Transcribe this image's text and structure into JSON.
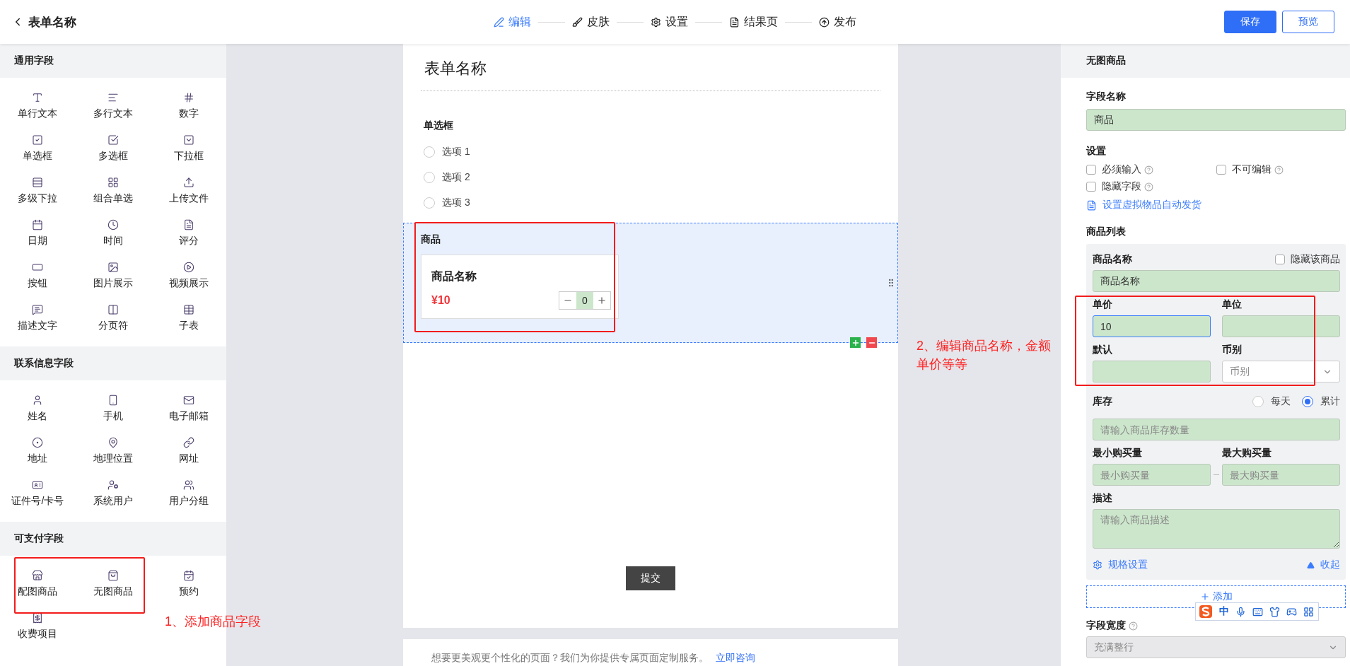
{
  "header": {
    "title": "表单名称",
    "steps": [
      {
        "label": "编辑",
        "selected": true
      },
      {
        "label": "皮肤",
        "selected": false
      },
      {
        "label": "设置",
        "selected": false
      },
      {
        "label": "结果页",
        "selected": false
      },
      {
        "label": "发布",
        "selected": false
      }
    ],
    "buttons": [
      {
        "label": "保存",
        "kind": "primary"
      },
      {
        "label": "预览",
        "kind": "outline"
      }
    ]
  },
  "sidebar": {
    "sections": [
      {
        "title": "通用字段",
        "items": [
          "单行文本",
          "多行文本",
          "数字",
          "单选框",
          "多选框",
          "下拉框",
          "多级下拉",
          "组合单选",
          "上传文件",
          "日期",
          "时间",
          "评分",
          "按钮",
          "图片展示",
          "视频展示",
          "描述文字",
          "分页符",
          "子表"
        ]
      },
      {
        "title": "联系信息字段",
        "items": [
          "姓名",
          "手机",
          "电子邮箱",
          "地址",
          "地理位置",
          "网址",
          "证件号/卡号",
          "系统用户",
          "用户分组"
        ]
      },
      {
        "title": "可支付字段",
        "items": [
          "配图商品",
          "无图商品",
          "预约",
          "收费项目"
        ]
      }
    ]
  },
  "form": {
    "title": "表单名称",
    "fields": [
      {
        "kind": "radio",
        "label": "单选框",
        "options": [
          {
            "label": "选项 1",
            "selected": false
          },
          {
            "label": "选项 2",
            "selected": false
          },
          {
            "label": "选项 3",
            "selected": false
          }
        ]
      },
      {
        "kind": "product",
        "label": "商品",
        "selected": true,
        "product_name": "商品名称",
        "price": "¥10",
        "quantity": "0"
      }
    ],
    "submit": "提交",
    "promo": {
      "text": "想要更美观更个性化的页面？我们为你提供专属页面定制服务。",
      "link": "立即咨询"
    }
  },
  "panel": {
    "title": "无图商品",
    "field_name": {
      "label": "字段名称",
      "value": "商品"
    },
    "settings": {
      "label": "设置",
      "options": [
        {
          "label": "必须输入",
          "checked": false
        },
        {
          "label": "不可编辑",
          "checked": false
        },
        {
          "label": "隐藏字段",
          "checked": false
        }
      ],
      "link": "设置虚拟物品自动发货"
    },
    "product_list": {
      "label": "商品列表",
      "name_label": "商品名称",
      "hide": {
        "label": "隐藏该商品",
        "checked": false
      },
      "name_value": "商品名称",
      "unit_price": {
        "label": "单价",
        "value": "10"
      },
      "unit": {
        "label": "单位"
      },
      "default": {
        "label": "默认"
      },
      "currency": {
        "label": "币别",
        "placeholder": "币别"
      },
      "stock": {
        "label": "库存",
        "modes": [
          {
            "label": "每天",
            "selected": false
          },
          {
            "label": "累计",
            "selected": true
          }
        ],
        "placeholder": "请输入商品库存数量"
      },
      "min": {
        "label": "最小购买量",
        "placeholder": "最小购买量"
      },
      "max": {
        "label": "最大购买量",
        "placeholder": "最大购买量"
      },
      "description": {
        "label": "描述",
        "placeholder": "请输入商品描述"
      },
      "spec_link": "规格设置",
      "collapse": "收起"
    },
    "add_button": "添加",
    "width": {
      "label": "字段宽度",
      "value": "充满整行"
    }
  },
  "annotations": [
    {
      "lines": [
        "1、添加商品字段"
      ]
    },
    {
      "lines": [
        "2、编辑商品名称，金额",
        "单价等等"
      ]
    }
  ],
  "ime": {
    "mode": "中"
  }
}
